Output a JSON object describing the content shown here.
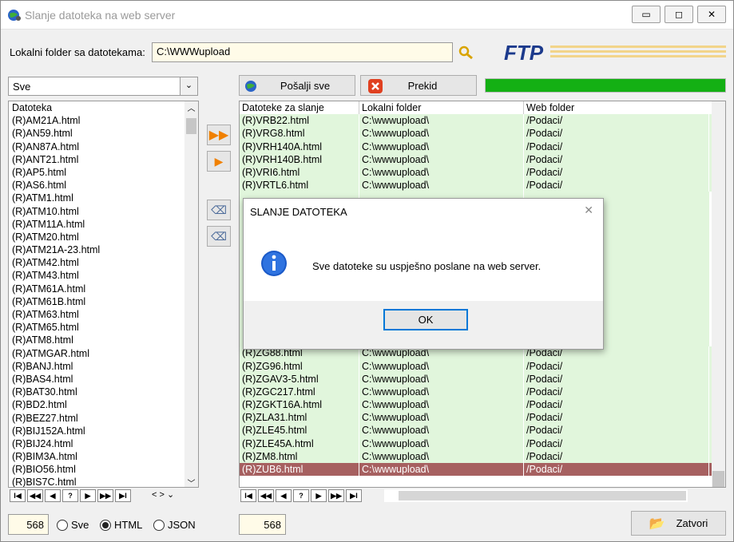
{
  "window": {
    "title": "Slanje datoteka na web server",
    "minimize": "▭",
    "maximize": "◻",
    "close": "✕"
  },
  "folder": {
    "label": "Lokalni folder sa datotekama:",
    "value": "C:\\WWWupload"
  },
  "logo": {
    "text": "FTP",
    "color": "#1c3a8c"
  },
  "filter": {
    "selected": "Sve"
  },
  "actions": {
    "send_all": "Pošalji sve",
    "abort": "Prekid",
    "progress": 1.0,
    "progress_color": "#14b014"
  },
  "left_list": {
    "header": "Datoteka",
    "items": [
      "(R)AM21A.html",
      "(R)AN59.html",
      "(R)AN87A.html",
      "(R)ANT21.html",
      "(R)AP5.html",
      "(R)AS6.html",
      "(R)ATM1.html",
      "(R)ATM10.html",
      "(R)ATM11A.html",
      "(R)ATM20.html",
      "(R)ATM21A-23.html",
      "(R)ATM42.html",
      "(R)ATM43.html",
      "(R)ATM61A.html",
      "(R)ATM61B.html",
      "(R)ATM63.html",
      "(R)ATM65.html",
      "(R)ATM8.html",
      "(R)ATMGAR.html",
      "(R)BANJ.html",
      "(R)BAS4.html",
      "(R)BAT30.html",
      "(R)BD2.html",
      "(R)BEZ27.html",
      "(R)BIJ152A.html",
      "(R)BIJ24.html",
      "(R)BIM3A.html",
      "(R)BIO56.html",
      "(R)BIS7C.html"
    ]
  },
  "grid": {
    "headers": [
      "Datoteke za slanje",
      "Lokalni folder",
      "Web folder"
    ],
    "top_rows": [
      [
        "(R)VRB22.html",
        "C:\\wwwupload\\",
        "/Podaci/"
      ],
      [
        "(R)VRG8.html",
        "C:\\wwwupload\\",
        "/Podaci/"
      ],
      [
        "(R)VRH140A.html",
        "C:\\wwwupload\\",
        "/Podaci/"
      ],
      [
        "(R)VRH140B.html",
        "C:\\wwwupload\\",
        "/Podaci/"
      ],
      [
        "(R)VRI6.html",
        "C:\\wwwupload\\",
        "/Podaci/"
      ],
      [
        "(R)VRTL6.html",
        "C:\\wwwupload\\",
        "/Podaci/"
      ]
    ],
    "bottom_rows": [
      [
        "(R)ZG88.html",
        "C:\\wwwupload\\",
        "/Podaci/"
      ],
      [
        "(R)ZG96.html",
        "C:\\wwwupload\\",
        "/Podaci/"
      ],
      [
        "(R)ZGAV3-5.html",
        "C:\\wwwupload\\",
        "/Podaci/"
      ],
      [
        "(R)ZGC217.html",
        "C:\\wwwupload\\",
        "/Podaci/"
      ],
      [
        "(R)ZGKT16A.html",
        "C:\\wwwupload\\",
        "/Podaci/"
      ],
      [
        "(R)ZLA31.html",
        "C:\\wwwupload\\",
        "/Podaci/"
      ],
      [
        "(R)ZLE45.html",
        "C:\\wwwupload\\",
        "/Podaci/"
      ],
      [
        "(R)ZLE45A.html",
        "C:\\wwwupload\\",
        "/Podaci/"
      ],
      [
        "(R)ZM8.html",
        "C:\\wwwupload\\",
        "/Podaci/"
      ]
    ],
    "selected_row": [
      "(R)ZUB6.html",
      "C:\\wwwupload\\",
      "/Podaci/"
    ]
  },
  "nav": {
    "first": "I◀",
    "prev_page": "◀◀",
    "prev": "◀",
    "help": "?",
    "next": "▶",
    "next_page": "▶▶",
    "last": "▶I"
  },
  "counts": {
    "left": "568",
    "right": "568"
  },
  "radios": {
    "all": "Sve",
    "html": "HTML",
    "json": "JSON",
    "selected": "html"
  },
  "close_button": "Zatvori",
  "dialog": {
    "title": "SLANJE DATOTEKA",
    "message": "Sve datoteke su uspješno poslane na web server.",
    "ok": "OK"
  }
}
